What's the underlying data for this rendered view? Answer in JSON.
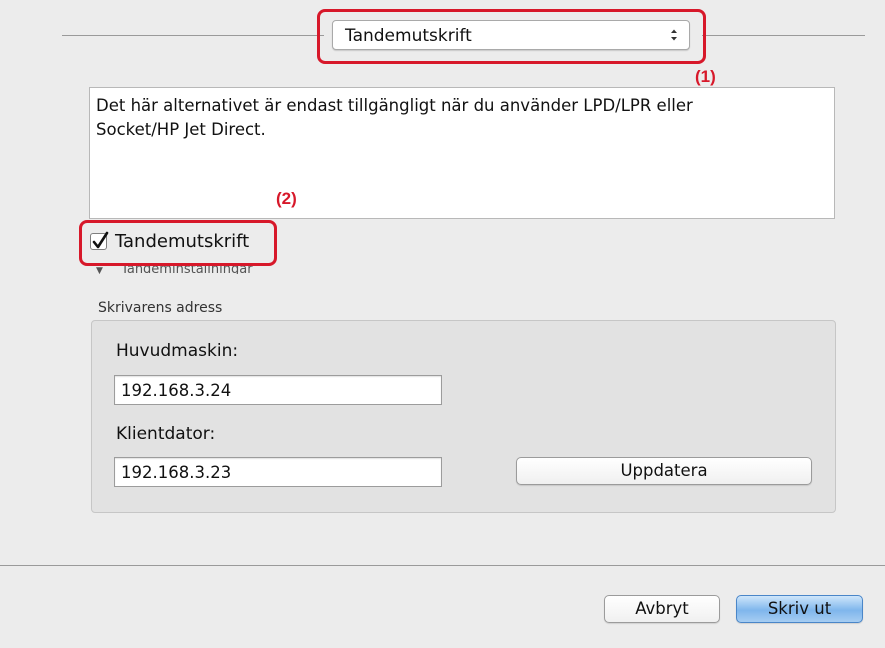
{
  "popup": {
    "selected": "Tandemutskrift"
  },
  "description": {
    "line1": "Det här alternativet är endast tillgängligt när du använder LPD/LPR eller",
    "line2": "Socket/HP Jet Direct."
  },
  "checkbox": {
    "label": "Tandemutskrift",
    "checked": true
  },
  "disclosure": {
    "label": "Tandeminställningar"
  },
  "group": {
    "title": "Skrivarens adress",
    "master_label": "Huvudmaskin:",
    "master_value": "192.168.3.24",
    "client_label": "Klientdator:",
    "client_value": "192.168.3.23",
    "update_button": "Uppdatera"
  },
  "footer": {
    "cancel": "Avbryt",
    "print": "Skriv ut"
  },
  "annotations": {
    "a1": "(1)",
    "a2": "(2)",
    "color": "#d7182a"
  }
}
